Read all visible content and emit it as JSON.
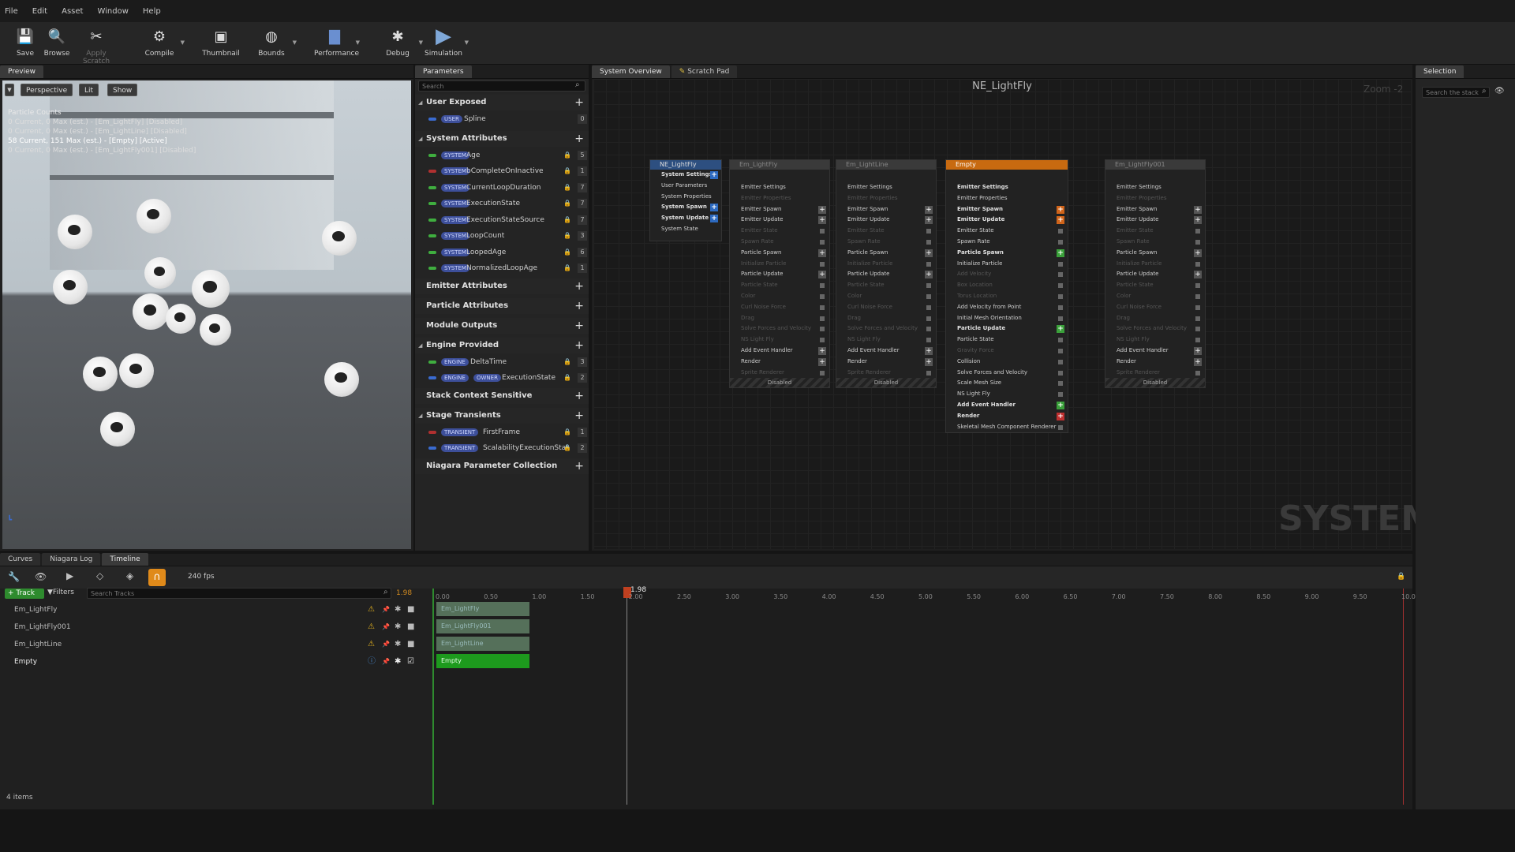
{
  "menu": [
    "File",
    "Edit",
    "Asset",
    "Window",
    "Help"
  ],
  "toolbar": [
    {
      "label": "Save",
      "icon": "save-icon",
      "glyph": "💾",
      "enabled": true
    },
    {
      "label": "Browse",
      "icon": "browse-icon",
      "glyph": "🔍",
      "enabled": true
    },
    {
      "label": "Apply Scratch",
      "icon": "apply-scratch-icon",
      "glyph": "✂",
      "enabled": false
    },
    {
      "label": "Compile",
      "icon": "compile-icon",
      "glyph": "⚙",
      "enabled": true
    },
    {
      "label": "Thumbnail",
      "icon": "thumbnail-icon",
      "glyph": "▣",
      "enabled": true
    },
    {
      "label": "Bounds",
      "icon": "bounds-icon",
      "glyph": "◍",
      "enabled": true
    },
    {
      "label": "Performance",
      "icon": "performance-icon",
      "glyph": "▇",
      "enabled": true
    },
    {
      "label": "Debug",
      "icon": "debug-icon",
      "glyph": "✱",
      "enabled": true
    },
    {
      "label": "Simulation",
      "icon": "simulation-icon",
      "glyph": "▶",
      "enabled": true
    }
  ],
  "preview": {
    "tab": "Preview",
    "perspective": "Perspective",
    "lit": "Lit",
    "show": "Show",
    "counts_title": "Particle Counts",
    "counts": [
      "0 Current, 0 Max (est.) - [Em_LightFly] [Disabled]",
      "0 Current, 0 Max (est.) - [Em_LightLine] [Disabled]",
      "58 Current, 151 Max (est.) - [Empty] [Active]",
      "0 Current, 0 Max (est.) - [Em_LightFly001] [Disabled]"
    ]
  },
  "params": {
    "tab": "Parameters",
    "search_placeholder": "Search",
    "user_exposed": "User Exposed",
    "user_badge": "USER",
    "spline": "Spline",
    "spline_count": "0",
    "system_attributes": "System Attributes",
    "system_badge": "SYSTEM",
    "system_rows": [
      {
        "name": "Age",
        "count": "5",
        "color": "#3fae3f"
      },
      {
        "name": "bCompleteOnInactive",
        "count": "1",
        "color": "#b03030"
      },
      {
        "name": "CurrentLoopDuration",
        "count": "7",
        "color": "#3fae3f"
      },
      {
        "name": "ExecutionState",
        "count": "7",
        "color": "#3fae3f"
      },
      {
        "name": "ExecutionStateSource",
        "count": "7",
        "color": "#3fae3f"
      },
      {
        "name": "LoopCount",
        "count": "3",
        "color": "#3fae3f"
      },
      {
        "name": "LoopedAge",
        "count": "6",
        "color": "#3fae3f"
      },
      {
        "name": "NormalizedLoopAge",
        "count": "1",
        "color": "#3fae3f"
      }
    ],
    "emitter_attributes": "Emitter Attributes",
    "particle_attributes": "Particle Attributes",
    "module_outputs": "Module Outputs",
    "engine_provided": "Engine Provided",
    "engine_badge": "ENGINE",
    "owner_badge": "OWNER",
    "engine_rows": [
      {
        "name": "DeltaTime",
        "count": "3",
        "color": "#3fae3f",
        "owner": false
      },
      {
        "name": "ExecutionState",
        "count": "2",
        "color": "#3a6bd0",
        "owner": true
      }
    ],
    "stack_context": "Stack Context Sensitive",
    "stage_transients": "Stage Transients",
    "transient_badge": "TRANSIENT",
    "transient_rows": [
      {
        "name": "FirstFrame",
        "count": "1",
        "color": "#b03030"
      },
      {
        "name": "ScalabilityExecutionStat",
        "count": "2",
        "color": "#3a6bd0"
      }
    ],
    "npc": "Niagara Parameter Collection"
  },
  "graph": {
    "tab1": "System Overview",
    "tab2": "Scratch Pad",
    "title": "NE_LightFly",
    "zoom": "Zoom -2",
    "watermark": "SYSTEM",
    "system_node": {
      "title": "NE_LightFly",
      "rows": [
        "System Settings",
        "User Parameters",
        "System Properties",
        "System Spawn",
        "System Update",
        "System State"
      ]
    },
    "emitter_rows": [
      "Emitter Settings",
      "Emitter Properties",
      "Emitter Spawn",
      "Emitter Update",
      "Emitter State",
      "Spawn Rate",
      "Particle Spawn",
      "Initialize Particle",
      "Particle Update",
      "Particle State",
      "Color",
      "Curl Noise Force",
      "Drag",
      "Solve Forces and Velocity",
      "NS Light Fly",
      "Add Event Handler",
      "Render",
      "Sprite Renderer"
    ],
    "empty_rows": [
      "Emitter Settings",
      "Emitter Properties",
      "Emitter Spawn",
      "Emitter Update",
      "Emitter State",
      "Spawn Rate",
      "Particle Spawn",
      "Initialize Particle",
      "Add Velocity",
      "Box Location",
      "Torus Location",
      "Add Velocity from Point",
      "Initial Mesh Orientation",
      "Particle Update",
      "Particle State",
      "Gravity Force",
      "Collision",
      "Solve Forces and Velocity",
      "Scale Mesh Size",
      "NS Light Fly",
      "Add Event Handler",
      "Render",
      "Skeletal Mesh Component Renderer"
    ],
    "emitters": [
      {
        "title": "Em_LightFly",
        "footer": "Disabled"
      },
      {
        "title": "Em_LightLine",
        "footer": "Disabled"
      },
      {
        "title": "Empty",
        "footer": ""
      },
      {
        "title": "Em_LightFly001",
        "footer": "Disabled"
      }
    ]
  },
  "selection": {
    "tab": "Selection",
    "search_placeholder": "Search the stack"
  },
  "timeline": {
    "tabs": [
      "Curves",
      "Niagara Log",
      "Timeline"
    ],
    "track_btn": "Track",
    "filters": "Filters",
    "search_placeholder": "Search Tracks",
    "fps": "240 fps",
    "time_value": "1.98",
    "playhead": "1.98",
    "ticks": [
      "0.00",
      "0.50",
      "1.00",
      "1.50",
      "2.00",
      "2.50",
      "3.00",
      "3.50",
      "4.00",
      "4.50",
      "5.00",
      "5.50",
      "6.00",
      "6.50",
      "7.00",
      "7.50",
      "8.00",
      "8.50",
      "9.00",
      "9.50",
      "10.0"
    ],
    "tracks": [
      "Em_LightFly",
      "Em_LightFly001",
      "Em_LightLine",
      "Empty"
    ],
    "segments": [
      "Em_LightFly",
      "Em_LightFly001",
      "Em_LightLine",
      "Empty"
    ],
    "status": "4 items"
  }
}
